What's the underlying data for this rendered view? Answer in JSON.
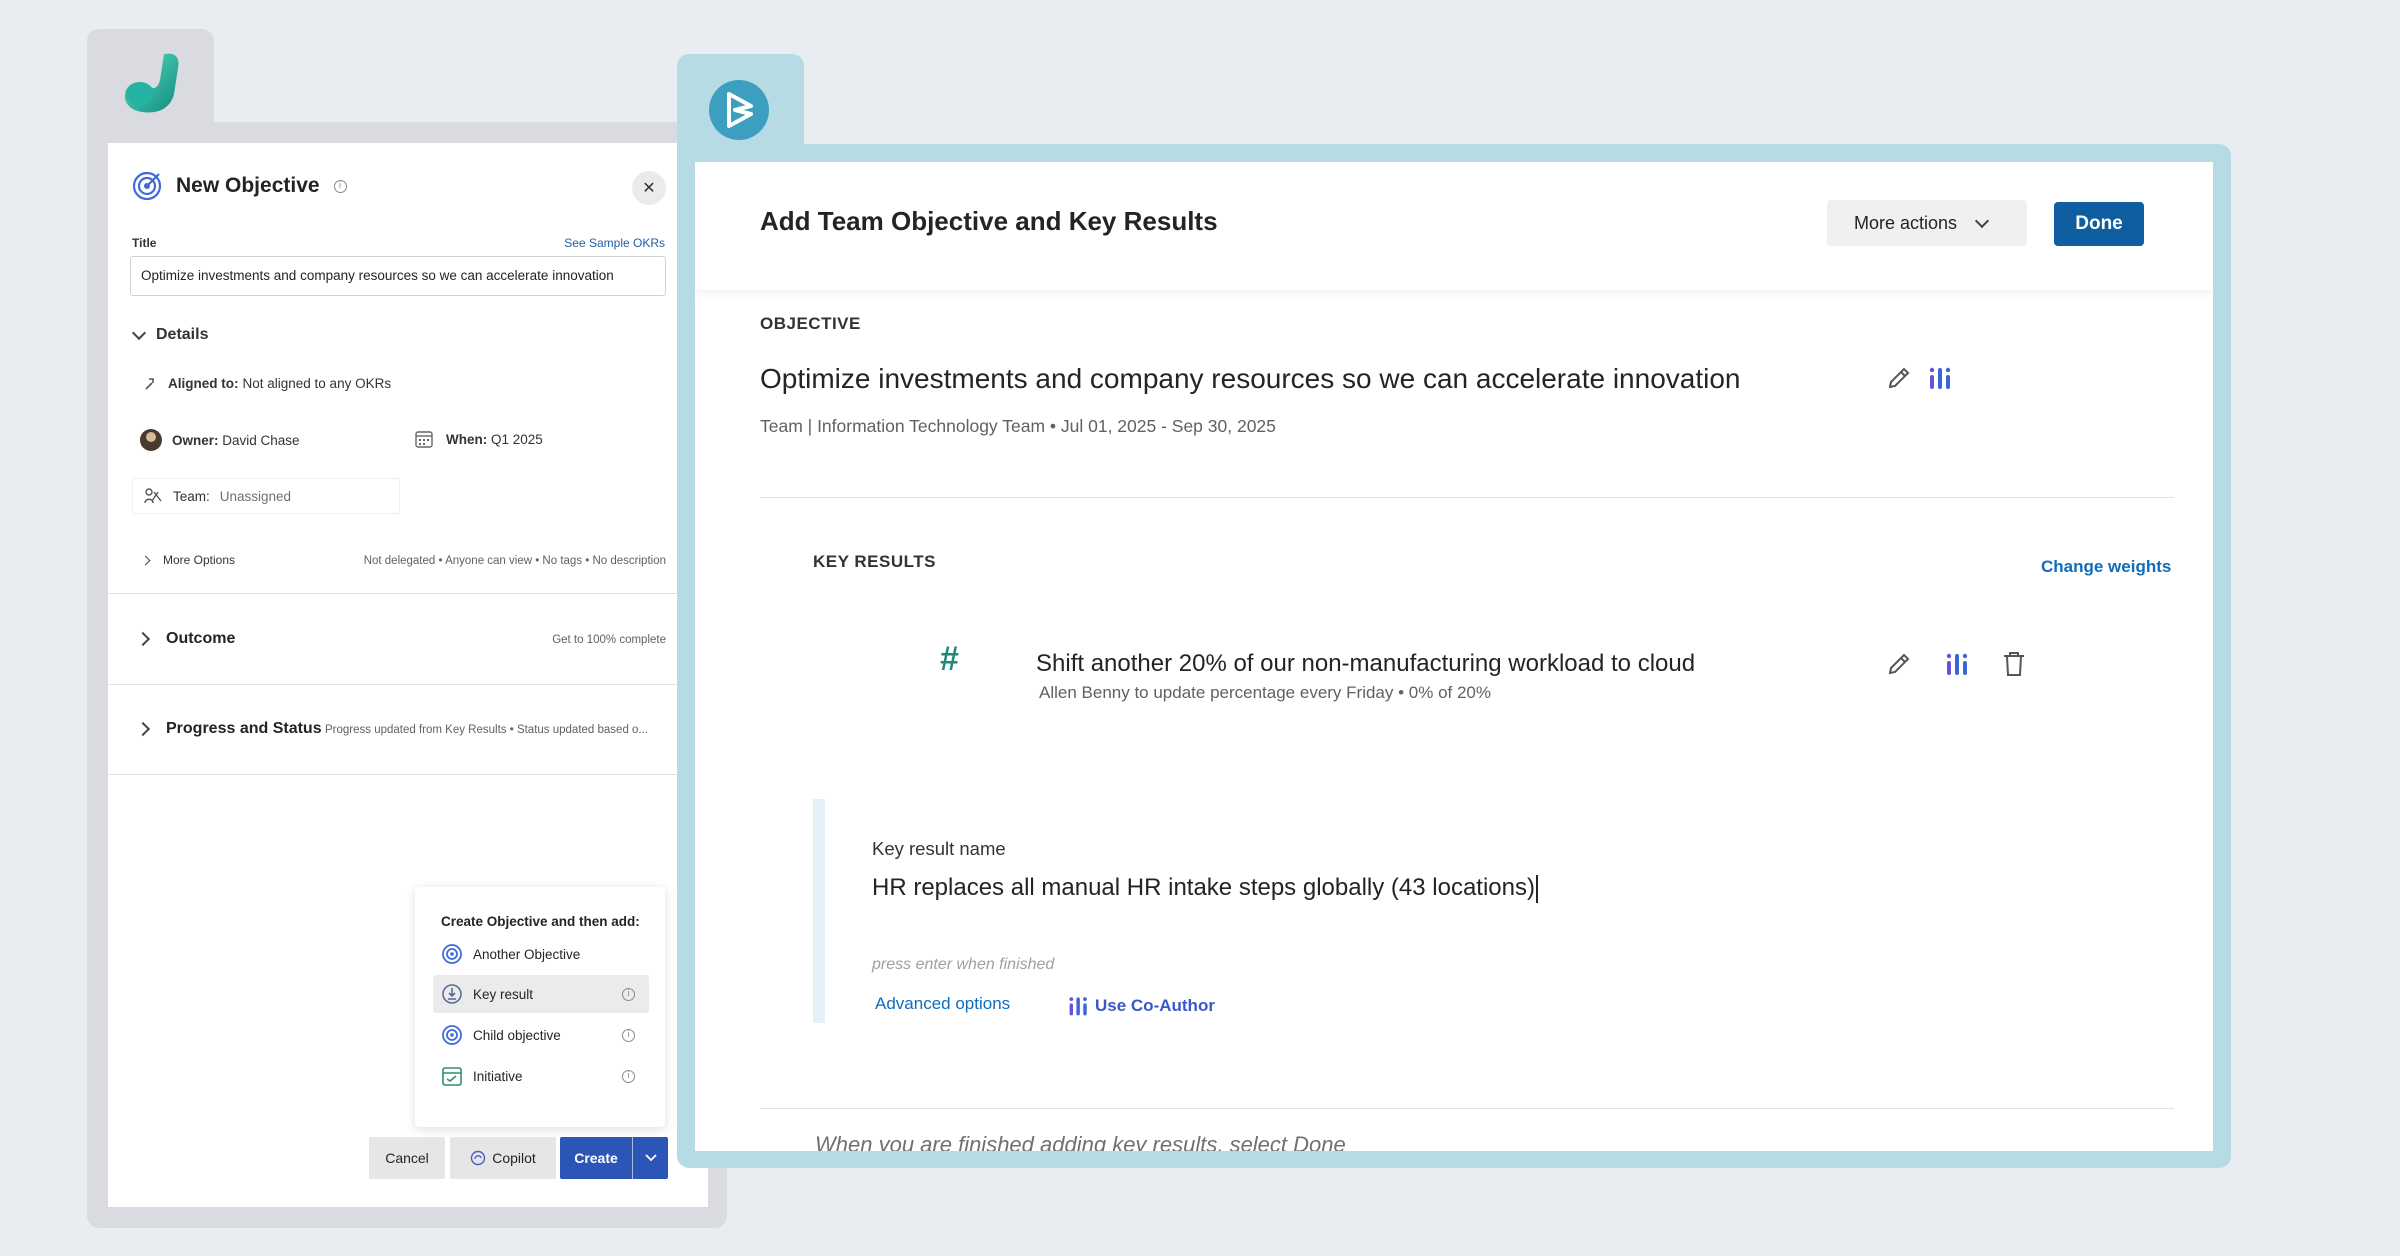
{
  "left_panel": {
    "header_title": "New Objective",
    "title_label": "Title",
    "see_sample": "See Sample OKRs",
    "title_value": "Optimize investments and company resources so we can accelerate innovation",
    "details_label": "Details",
    "aligned_label": "Aligned to:",
    "aligned_value": "Not aligned to any OKRs",
    "owner_label": "Owner:",
    "owner_value": "David Chase",
    "when_label": "When:",
    "when_value": "Q1 2025",
    "team_label": "Team:",
    "team_value": "Unassigned",
    "more_options_label": "More Options",
    "more_options_summary": "Not delegated • Anyone can view • No tags • No description",
    "outcome_label": "Outcome",
    "outcome_summary": "Get to 100% complete",
    "progress_label": "Progress and Status",
    "progress_summary": "Progress updated from Key Results • Status updated based o...",
    "popup": {
      "heading": "Create Objective and then add:",
      "items": [
        {
          "label": "Another Objective",
          "icon": "target-icon"
        },
        {
          "label": "Key result",
          "icon": "key-result-icon"
        },
        {
          "label": "Child objective",
          "icon": "target-icon"
        },
        {
          "label": "Initiative",
          "icon": "calendar-icon"
        }
      ]
    },
    "cancel_label": "Cancel",
    "copilot_label": "Copilot",
    "create_label": "Create"
  },
  "right_panel": {
    "page_title": "Add Team Objective and Key Results",
    "more_actions_label": "More actions",
    "done_label": "Done",
    "objective_section": "OBJECTIVE",
    "objective_title": "Optimize investments and company resources so we can accelerate innovation",
    "objective_meta": "Team | Information Technology Team • Jul 01, 2025 - Sep 30, 2025",
    "key_results_section": "KEY RESULTS",
    "change_weights": "Change weights",
    "key_result": {
      "title": "Shift another 20% of our non-manufacturing workload to cloud",
      "meta": "Allen Benny to update percentage every Friday  •  0% of 20%"
    },
    "kr_name_label": "Key result name",
    "kr_name_value": "HR replaces all manual HR intake steps globally (43 locations)",
    "hint": "press enter when finished",
    "advanced_options": "Advanced options",
    "use_coauthor": "Use Co-Author",
    "finish_hint": "When you are finished adding key results, select Done"
  },
  "colors": {
    "primary_blue": "#2c55b8",
    "done_blue": "#0f5fa0",
    "link_blue": "#0f6cbd",
    "teal_frame": "#b6dbe5",
    "hash_green": "#1f8a7a"
  }
}
